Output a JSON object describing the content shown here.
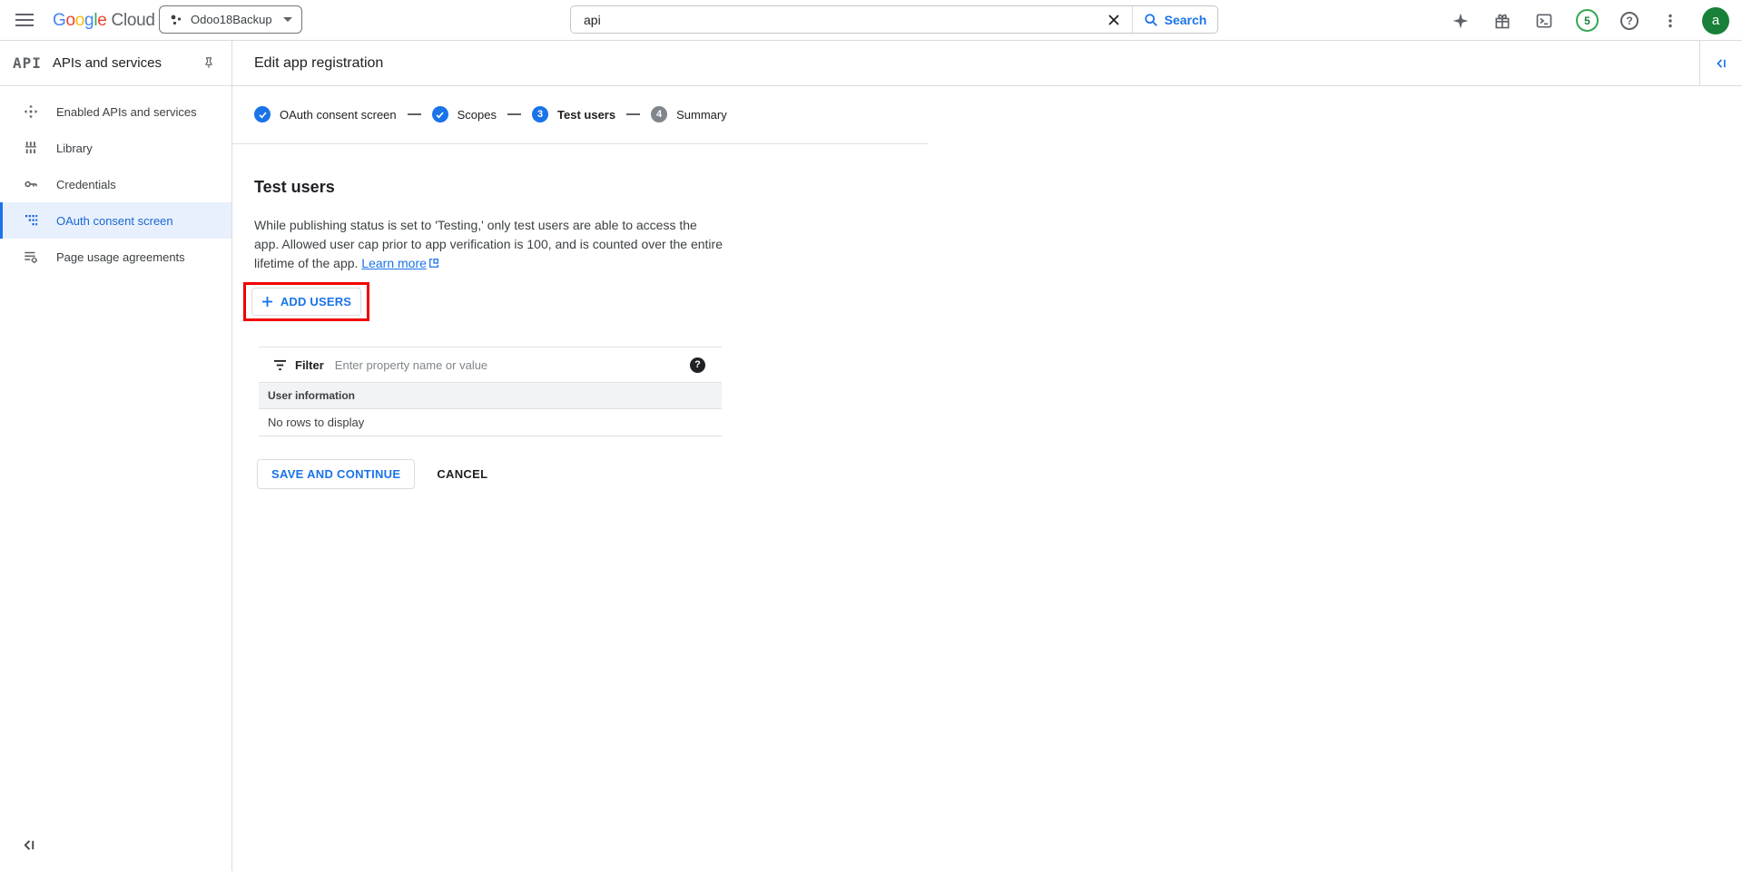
{
  "topbar": {
    "logo_letters": [
      "G",
      "o",
      "o",
      "g",
      "l",
      "e"
    ],
    "logo_suffix": "Cloud",
    "project_selector_label": "Odoo18Backup",
    "search_value": "api",
    "search_button_label": "Search",
    "notification_count": "5",
    "avatar_letter": "a"
  },
  "glyphs": {
    "question_mark": "?"
  },
  "sidebar": {
    "logo": "API",
    "title": "APIs and services",
    "items": [
      {
        "label": "Enabled APIs and services",
        "selected": false
      },
      {
        "label": "Library",
        "selected": false
      },
      {
        "label": "Credentials",
        "selected": false
      },
      {
        "label": "OAuth consent screen",
        "selected": true
      },
      {
        "label": "Page usage agreements",
        "selected": false
      }
    ]
  },
  "main": {
    "page_title": "Edit app registration",
    "stepper": {
      "steps": [
        {
          "label": "OAuth consent screen",
          "state": "done"
        },
        {
          "label": "Scopes",
          "state": "done"
        },
        {
          "label": "Test users",
          "number": "3",
          "state": "active"
        },
        {
          "label": "Summary",
          "number": "4",
          "state": "upcoming"
        }
      ]
    },
    "test_users": {
      "heading": "Test users",
      "description": "While publishing status is set to 'Testing,' only test users are able to access the app. Allowed user cap prior to app verification is 100, and is counted over the entire lifetime of the app.",
      "learn_more_label": "Learn more",
      "add_users_label": "ADD USERS"
    },
    "filter": {
      "label": "Filter",
      "placeholder": "Enter property name or value"
    },
    "table": {
      "header": "User information",
      "empty_message": "No rows to display"
    },
    "actions": {
      "save_label": "SAVE AND CONTINUE",
      "cancel_label": "CANCEL"
    }
  },
  "colors": {
    "accent_blue": "#1a73e8",
    "selected_nav_bg": "#e8f0fe",
    "selected_nav_text": "#1967d2",
    "avatar_green": "#188038",
    "notification_ring_green": "#34a853",
    "annotation_highlight_red": "#f00000"
  }
}
